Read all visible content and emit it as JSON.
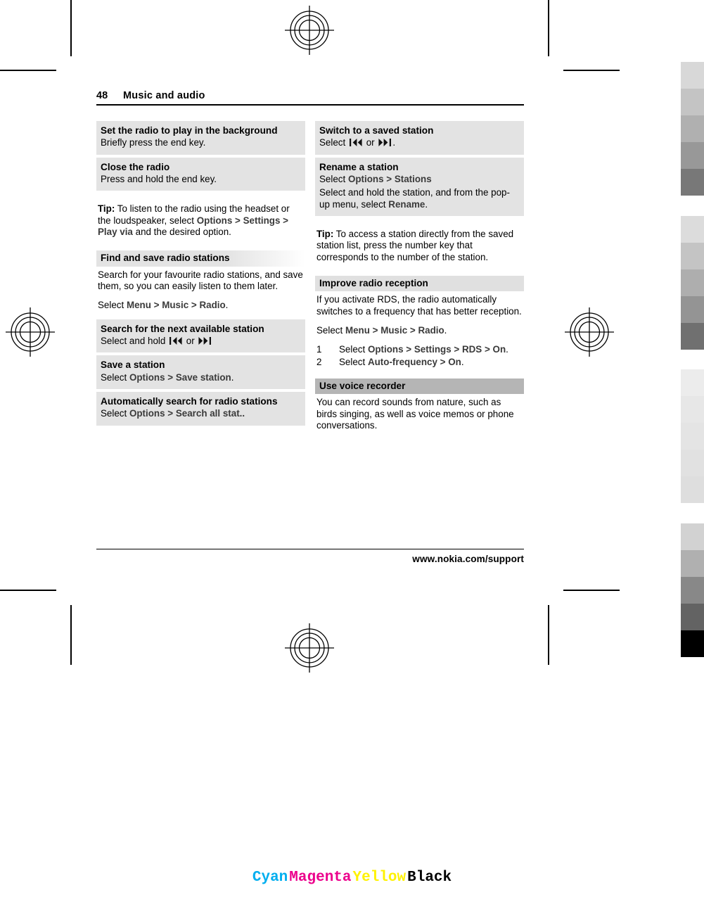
{
  "page": {
    "number": "48",
    "section_title": "Music and audio",
    "footer_url": "www.nokia.com/support"
  },
  "icons": {
    "rewind": "rewind-icon",
    "forward": "fast-forward-icon",
    "registration": "registration-mark-icon"
  },
  "left_column": {
    "blocks": [
      {
        "id": "set-radio-background",
        "heading": "Set the radio to play in the background",
        "lines": [
          "Briefly press the end key."
        ]
      },
      {
        "id": "close-the-radio",
        "heading": "Close the radio",
        "lines": [
          "Press and hold the end key."
        ]
      }
    ],
    "tip": {
      "label": "Tip:",
      "text_before": "To listen to the radio using the headset or the loudspeaker, select",
      "commands": [
        "Options",
        "Settings",
        "Play via"
      ],
      "text_after": "and the desired option."
    },
    "section": {
      "heading": "Find and save radio stations",
      "intro": "Search for your favourite radio stations, and save them, so you can easily listen to them later.",
      "select_prefix": "Select",
      "select_path": [
        "Menu",
        "Music",
        "Radio"
      ],
      "select_suffix": "."
    },
    "sub_blocks": [
      {
        "id": "search-next-station",
        "heading": "Search for the next available station",
        "line_prefix": "Select and hold",
        "line_join": "or",
        "line_suffix": ""
      },
      {
        "id": "save-a-station",
        "heading": "Save a station",
        "select_prefix": "Select",
        "commands": [
          "Options",
          "Save station"
        ],
        "suffix": "."
      },
      {
        "id": "auto-search-stations",
        "heading": "Automatically search for radio stations",
        "select_prefix": "Select",
        "commands": [
          "Options",
          "Search all stat.."
        ],
        "suffix": ""
      }
    ]
  },
  "right_column": {
    "blocks": [
      {
        "id": "switch-saved-station",
        "heading": "Switch to a saved station",
        "line_prefix": "Select",
        "line_join": "or",
        "line_suffix": "."
      },
      {
        "id": "rename-a-station",
        "heading": "Rename a station",
        "select_prefix": "Select",
        "commands": [
          "Options",
          "Stations"
        ],
        "detail_before": "Select and hold the station, and from the pop-up menu, select",
        "detail_command": "Rename",
        "detail_after": "."
      }
    ],
    "tip": {
      "label": "Tip:",
      "text": "To access a station directly from the saved station list, press the number key that corresponds to the number of the station."
    },
    "section_reception": {
      "heading": "Improve radio reception",
      "intro": "If you activate RDS, the radio automatically switches to a frequency that has better reception.",
      "select_prefix": "Select",
      "select_path": [
        "Menu",
        "Music",
        "Radio"
      ],
      "select_suffix": ".",
      "steps": [
        {
          "n": "1",
          "prefix": "Select",
          "commands": [
            "Options",
            "Settings",
            "RDS",
            "On"
          ],
          "suffix": "."
        },
        {
          "n": "2",
          "prefix": "Select",
          "commands": [
            "Auto-frequency",
            "On"
          ],
          "suffix": "."
        }
      ]
    },
    "section_recorder": {
      "heading": "Use voice recorder",
      "intro": "You can record sounds from nature, such as birds singing, as well as voice memos or phone conversations."
    }
  },
  "color_bar": {
    "items": [
      {
        "label": "Cyan",
        "color": "#00aeef"
      },
      {
        "label": "Magenta",
        "color": "#ec008c"
      },
      {
        "label": "Yellow",
        "color": "#fff200"
      },
      {
        "label": "Black",
        "color": "#000000"
      }
    ]
  },
  "calibration_swatches": {
    "group1": [
      "#d8d8d8",
      "#c4c4c4",
      "#b0b0b0",
      "#989898",
      "#787878"
    ],
    "group2": [
      "#dcdcdc",
      "#c4c4c4",
      "#aeaeae",
      "#949494",
      "#707070"
    ],
    "group3": [
      "#ececec",
      "#e7e7e7",
      "#e4e4e4",
      "#e1e1e1",
      "#dedede"
    ],
    "group4": [
      "#d2d2d2",
      "#b0b0b0",
      "#888888",
      "#636363",
      "#000000"
    ]
  }
}
